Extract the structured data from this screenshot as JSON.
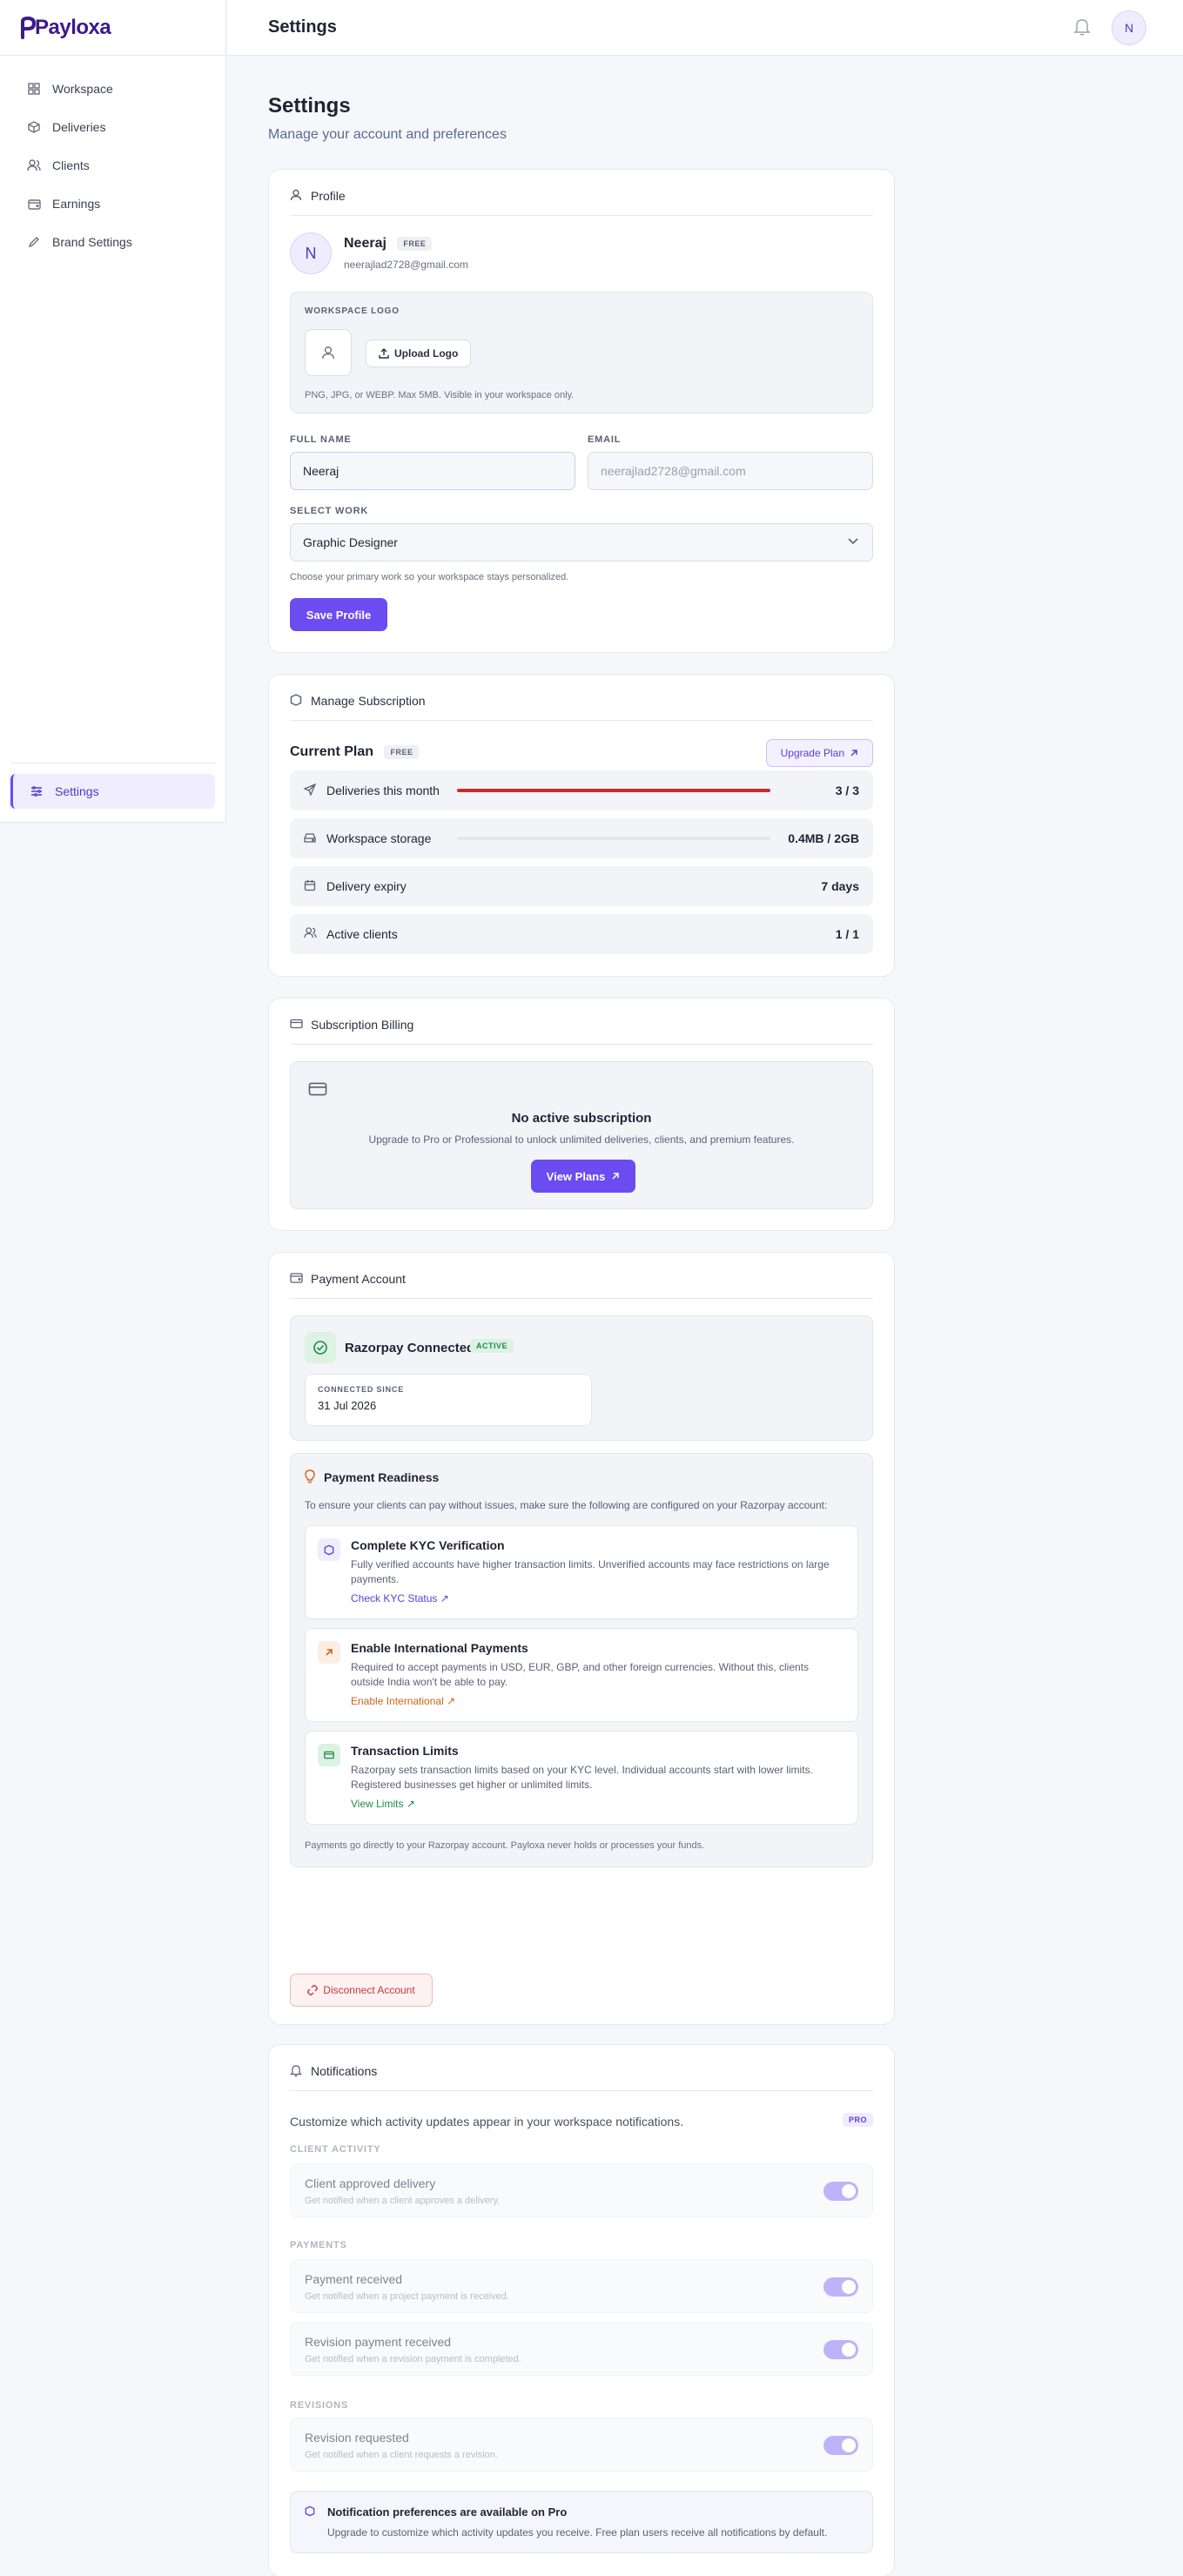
{
  "app": {
    "logo": "Payloxa"
  },
  "sidebar": {
    "items": [
      {
        "label": "Workspace",
        "icon": "grid-icon"
      },
      {
        "label": "Deliveries",
        "icon": "box-icon"
      },
      {
        "label": "Clients",
        "icon": "users-icon"
      },
      {
        "label": "Earnings",
        "icon": "wallet-icon"
      },
      {
        "label": "Brand Settings",
        "icon": "pen-icon"
      }
    ],
    "bottom": {
      "label": "Settings",
      "icon": "sliders-icon"
    }
  },
  "topbar": {
    "title": "Settings",
    "avatar": "N"
  },
  "page": {
    "title": "Settings",
    "subtitle": "Manage your account and preferences"
  },
  "profile": {
    "heading": "Profile",
    "avatar": "N",
    "name": "Neeraj",
    "plan_badge": "FREE",
    "email": "neerajlad2728@gmail.com",
    "logo_label": "WORKSPACE LOGO",
    "upload_label": "Upload Logo",
    "logo_hint": "PNG, JPG, or WEBP. Max 5MB. Visible in your workspace only.",
    "full_name_label": "FULL NAME",
    "full_name_value": "Neeraj",
    "email_label": "EMAIL",
    "email_placeholder": "neerajlad2728@gmail.com",
    "work_label": "SELECT WORK",
    "work_value": "Graphic Designer",
    "work_hint": "Choose your primary work so your workspace stays personalized.",
    "save_label": "Save Profile"
  },
  "subscription": {
    "heading": "Manage Subscription",
    "current_plan_label": "Current Plan",
    "plan_badge": "FREE",
    "upgrade_label": "Upgrade Plan",
    "rows": [
      {
        "label": "Deliveries this month",
        "value": "3 / 3",
        "fill_fraction": 1.0
      },
      {
        "label": "Workspace storage",
        "value": "0.4MB / 2GB",
        "fill_fraction": 0.0002
      },
      {
        "label": "Delivery expiry",
        "value": "7 days"
      },
      {
        "label": "Active clients",
        "value": "1 / 1"
      }
    ],
    "bar_color": "#cc2a2a"
  },
  "billing": {
    "heading": "Subscription Billing",
    "empty_title": "No active subscription",
    "empty_text": "Upgrade to Pro or Professional to unlock unlimited deliveries, clients, and premium features.",
    "view_plans_label": "View Plans"
  },
  "payment": {
    "heading": "Payment Account",
    "provider": "Razorpay Connected",
    "status_badge": "ACTIVE",
    "since_label": "CONNECTED SINCE",
    "since_value": "31 Jul 2026",
    "readiness_title": "Payment Readiness",
    "readiness_text": "To ensure your clients can pay without issues, make sure the following are configured on your Razorpay account:",
    "tips": [
      {
        "title": "Complete KYC Verification",
        "text": "Fully verified accounts have higher transaction limits. Unverified accounts may face restrictions on large payments.",
        "link": "Check KYC Status",
        "color": "#5b3fd6"
      },
      {
        "title": "Enable International Payments",
        "text": "Required to accept payments in USD, EUR, GBP, and other foreign currencies. Without this, clients outside India won't be able to pay.",
        "link": "Enable International",
        "color": "#d0651a"
      },
      {
        "title": "Transaction Limits",
        "text": "Razorpay sets transaction limits based on your KYC level. Individual accounts start with lower limits. Registered businesses get higher or unlimited limits.",
        "link": "View Limits",
        "color": "#1f8a4c"
      }
    ],
    "footer_note": "Payments go directly to your Razorpay account. Payloxa never holds or processes your funds.",
    "disconnect_label": "Disconnect Account"
  },
  "notifications": {
    "heading": "Notifications",
    "intro": "Customize which activity updates appear in your workspace notifications.",
    "pro_badge": "PRO",
    "sections": {
      "client_activity": "CLIENT ACTIVITY",
      "payments": "PAYMENTS",
      "revisions": "REVISIONS"
    },
    "items": [
      {
        "title": "Client approved delivery",
        "desc": "Get notified when a client approves a delivery."
      },
      {
        "title": "Payment received",
        "desc": "Get notified when a project payment is received."
      },
      {
        "title": "Revision payment received",
        "desc": "Get notified when a revision payment is completed."
      },
      {
        "title": "Revision requested",
        "desc": "Get notified when a client requests a revision."
      }
    ],
    "pro_title": "Notification preferences are available on Pro",
    "pro_text": "Upgrade to customize which activity updates you receive. Free plan users receive all notifications by default."
  }
}
